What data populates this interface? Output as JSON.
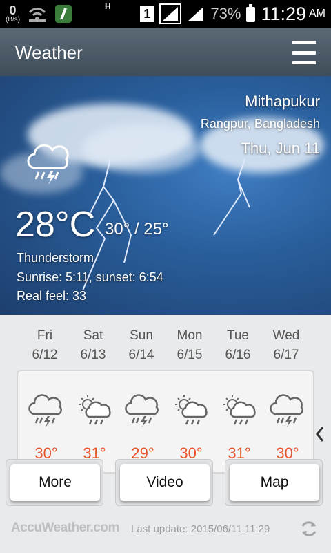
{
  "status_bar": {
    "data_count": "0",
    "data_rate": "(B/s)",
    "network_type": "H",
    "sim_slot": "1",
    "battery_pct": "73%",
    "time": "11:29",
    "ampm": "AM"
  },
  "app": {
    "title": "Weather",
    "menu_icon": "hamburger-menu-icon"
  },
  "location": {
    "city": "Mithapukur",
    "region": "Rangpur, Bangladesh",
    "date": "Thu, Jun 11"
  },
  "current": {
    "icon": "thunderstorm-icon",
    "temp": "28°C",
    "hi_lo": "30° / 25°",
    "condition": "Thunderstorm",
    "sun": "Sunrise: 5:11, sunset: 6:54",
    "real_feel": "Real feel: 33"
  },
  "forecast": [
    {
      "day": "Fri",
      "date": "6/12",
      "icon": "thunderstorm-icon",
      "high": "30°"
    },
    {
      "day": "Sat",
      "date": "6/13",
      "icon": "partly-sunny-rain-icon",
      "high": "31°"
    },
    {
      "day": "Sun",
      "date": "6/14",
      "icon": "thunderstorm-icon",
      "high": "29°"
    },
    {
      "day": "Mon",
      "date": "6/15",
      "icon": "partly-sunny-rain-icon",
      "high": "30°"
    },
    {
      "day": "Tue",
      "date": "6/16",
      "icon": "partly-sunny-rain-icon",
      "high": "31°"
    },
    {
      "day": "Wed",
      "date": "6/17",
      "icon": "thunderstorm-icon",
      "high": "30°"
    }
  ],
  "buttons": {
    "more": "More",
    "video": "Video",
    "map": "Map"
  },
  "footer": {
    "brand": "AccuWeather.com",
    "last_update": "Last update: 2015/06/11 11:29"
  },
  "colors": {
    "temp_high": "#e8542a",
    "action_bar": "#4a5865",
    "hero_sky": "#2a5f9c"
  }
}
